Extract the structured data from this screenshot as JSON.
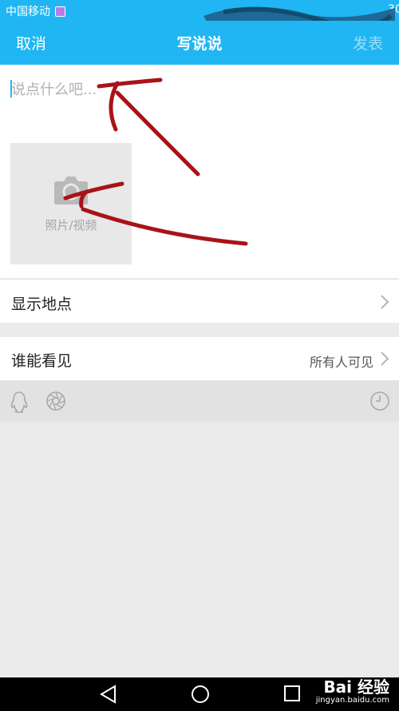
{
  "status_bar": {
    "carrier": "中国移动",
    "time": "30"
  },
  "header": {
    "cancel_label": "取消",
    "title": "写说说",
    "publish_label": "发表"
  },
  "compose": {
    "placeholder": "说点什么吧..."
  },
  "media": {
    "label": "照片/视频",
    "icon": "camera-icon"
  },
  "location_row": {
    "label": "显示地点",
    "icon": "chevron-right-icon"
  },
  "visibility_row": {
    "label": "谁能看见",
    "value": "所有人可见",
    "icon": "chevron-right-icon"
  },
  "toolbar": {
    "icons": [
      "qq-penguin-icon",
      "aperture-icon",
      "clock-icon"
    ]
  },
  "nav_bar": {
    "icons": [
      "back-triangle-icon",
      "home-circle-icon",
      "recents-square-icon"
    ]
  },
  "watermark": {
    "brand": "Bai 经验",
    "url": "jingyan.baidu.com"
  },
  "colors": {
    "accent": "#1fb6f3",
    "annotation": "#a81318",
    "background": "#ebebeb"
  }
}
